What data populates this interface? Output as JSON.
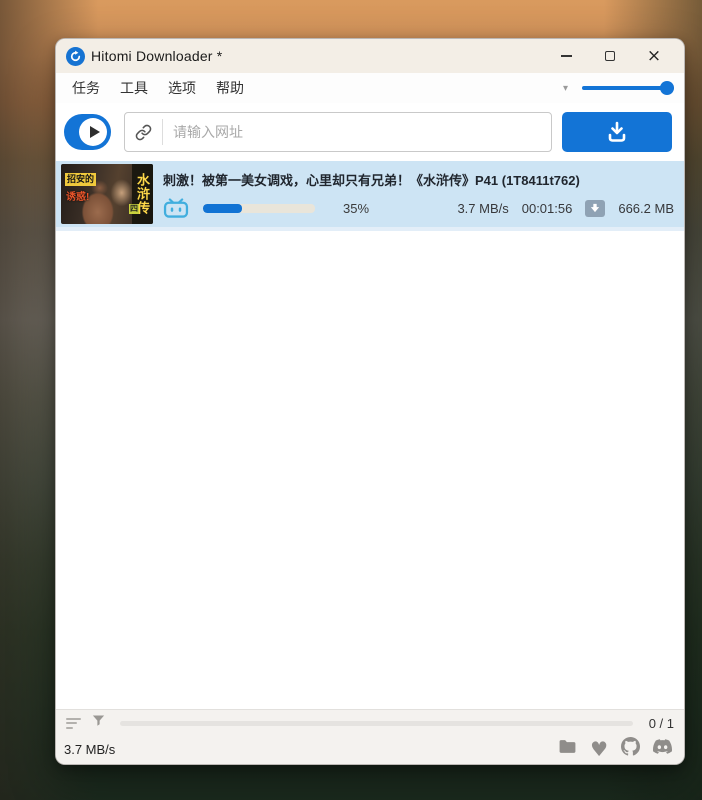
{
  "window": {
    "title": "Hitomi Downloader *"
  },
  "menubar": {
    "items": [
      "任务",
      "工具",
      "选项",
      "帮助"
    ],
    "dropdown_glyph": "▾"
  },
  "toolbar": {
    "url_placeholder": "请输入网址"
  },
  "download_item": {
    "title": "刺激！被第一美女调戏，心里却只有兄弟！《水浒传》P41 (1T8411t762)",
    "percent_label": "35%",
    "percent_width": "35%",
    "speed": "3.7 MB/s",
    "eta": "00:01:56",
    "size": "666.2 MB",
    "thumbnail": {
      "tag_line1": "招安的",
      "tag_line2": "诱惑!",
      "banner_text": "水浒传",
      "badge": "四"
    }
  },
  "statusbar": {
    "counter": "0 / 1",
    "total_speed": "3.7 MB/s",
    "heart_glyph": "♥"
  },
  "icons": {
    "app_logo": "refresh-swirl-icon",
    "window_controls": [
      "minimize-icon",
      "maximize-icon",
      "close-icon"
    ],
    "toolbar": [
      "play-icon",
      "link-icon",
      "download-icon"
    ],
    "item": [
      "bilibili-icon",
      "download-state-icon"
    ],
    "statusbar": [
      "sort-icon",
      "filter-funnel-icon",
      "folder-icon",
      "heart-icon",
      "github-icon",
      "discord-icon"
    ]
  },
  "colors": {
    "accent_blue": "#1374d6",
    "titlebar_bg": "#f3eee6",
    "item_highlight": "#cde4f4",
    "progress_fill": "#1173d4",
    "progress_track": "#e9e5da",
    "bilibili_blue": "#41aede",
    "statusbar_bg": "#f4f2ef",
    "gray_icon": "#8f8d8a"
  }
}
